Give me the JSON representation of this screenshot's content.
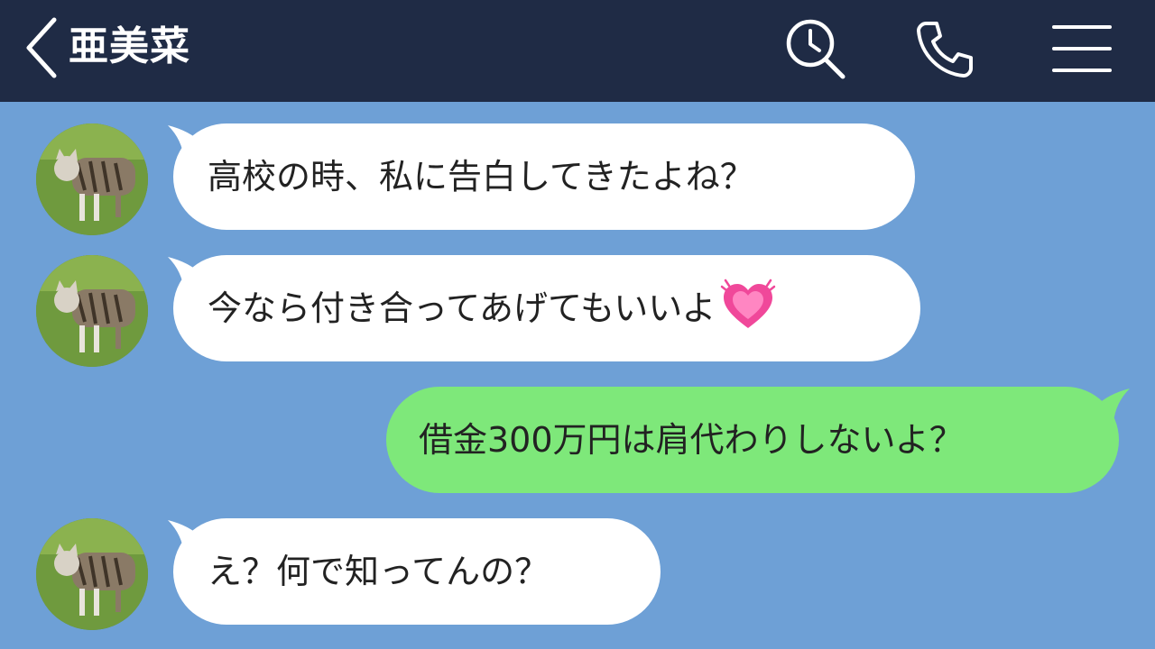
{
  "header": {
    "contact_name": "亜美菜",
    "icons": [
      "chevron-left-icon",
      "search-history-icon",
      "phone-icon",
      "menu-icon"
    ]
  },
  "colors": {
    "header_bg": "#1f2b45",
    "chat_bg": "#6ea0d6",
    "incoming_bubble": "#ffffff",
    "outgoing_bubble": "#7ee87a"
  },
  "messages": [
    {
      "direction": "incoming",
      "text": "高校の時、私に告白してきたよね？"
    },
    {
      "direction": "incoming",
      "text": "今なら付き合ってあげてもいいよ",
      "emoji": "growing-heart-emoji"
    },
    {
      "direction": "outgoing",
      "text": "借金300万円は肩代わりしないよ？"
    },
    {
      "direction": "incoming",
      "text": "え？何で知ってんの？"
    }
  ]
}
